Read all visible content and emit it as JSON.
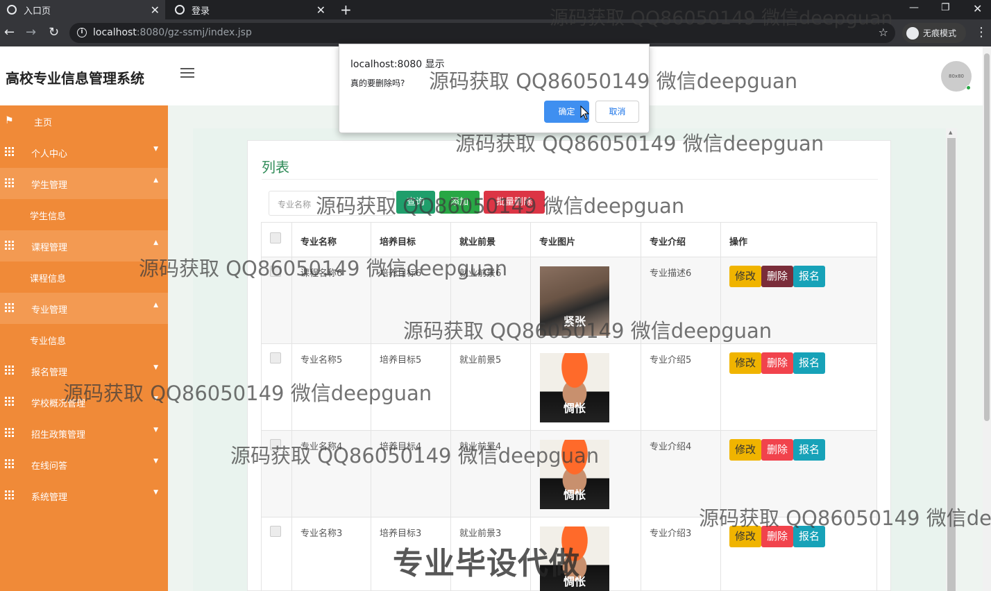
{
  "browser": {
    "tabs": [
      {
        "label": "入口页",
        "active": true
      },
      {
        "label": "登录",
        "active": false
      }
    ],
    "url_host": "localhost",
    "url_rest": ":8080/gz-ssmj/index.jsp",
    "incognito_label": "无痕模式"
  },
  "app": {
    "title": "高校专业信息管理系统",
    "avatar_text": "80x80"
  },
  "sidebar": {
    "items": [
      {
        "label": "主页",
        "icon": "flag-icon"
      },
      {
        "label": "个人中心",
        "icon": "grid-icon",
        "caret": "down"
      },
      {
        "label": "学生管理",
        "icon": "grid-icon",
        "caret": "up",
        "children": [
          "学生信息"
        ]
      },
      {
        "label": "课程管理",
        "icon": "grid-icon",
        "caret": "up",
        "children": [
          "课程信息"
        ]
      },
      {
        "label": "专业管理",
        "icon": "grid-icon",
        "caret": "up",
        "children": [
          "专业信息"
        ]
      },
      {
        "label": "报名管理",
        "icon": "grid-icon",
        "caret": "down"
      },
      {
        "label": "学校概况管理",
        "icon": "grid-icon",
        "caret": "down"
      },
      {
        "label": "招生政策管理",
        "icon": "grid-icon",
        "caret": "down"
      },
      {
        "label": "在线问答",
        "icon": "grid-icon",
        "caret": "down"
      },
      {
        "label": "系统管理",
        "icon": "grid-icon",
        "caret": "down"
      }
    ]
  },
  "main": {
    "card_title": "列表",
    "search_placeholder": "专业名称",
    "buttons": {
      "query": "查询",
      "add": "添加",
      "batch_delete": "批量删除"
    },
    "table": {
      "headers": [
        "专业名称",
        "培养目标",
        "就业前景",
        "专业图片",
        "专业介绍",
        "操作"
      ],
      "rows": [
        {
          "name": "课程名称6",
          "goal": "培养目标6",
          "prospect": "就业前景6",
          "image_caption": "紧张",
          "intro": "专业描述6"
        },
        {
          "name": "专业名称5",
          "goal": "培养目标5",
          "prospect": "就业前景5",
          "image_caption": "惆怅",
          "intro": "专业介绍5"
        },
        {
          "name": "专业名称4",
          "goal": "培养目标4",
          "prospect": "就业前景4",
          "image_caption": "惆怅",
          "intro": "专业介绍4"
        },
        {
          "name": "专业名称3",
          "goal": "培养目标3",
          "prospect": "就业前景3",
          "image_caption": "惆怅",
          "intro": "专业介绍3"
        }
      ],
      "actions": {
        "edit": "修改",
        "delete": "删除",
        "enroll": "报名"
      }
    }
  },
  "dialog": {
    "origin": "localhost:8080 显示",
    "message": "真的要删除吗?",
    "ok": "确定",
    "cancel": "取消"
  },
  "watermark": {
    "text": "源码获取 QQ86050149 微信deepguan",
    "text_cut": "源码获取 QQ86050149 微信de",
    "banner": "专业毕设代做"
  },
  "colors": {
    "sidebar": "#f08a38",
    "title_green": "#2e8b57",
    "edit": "#f0b400",
    "delete": "#f1434c",
    "enroll": "#17a2b8",
    "dialog_ok": "#3f8ff0"
  }
}
